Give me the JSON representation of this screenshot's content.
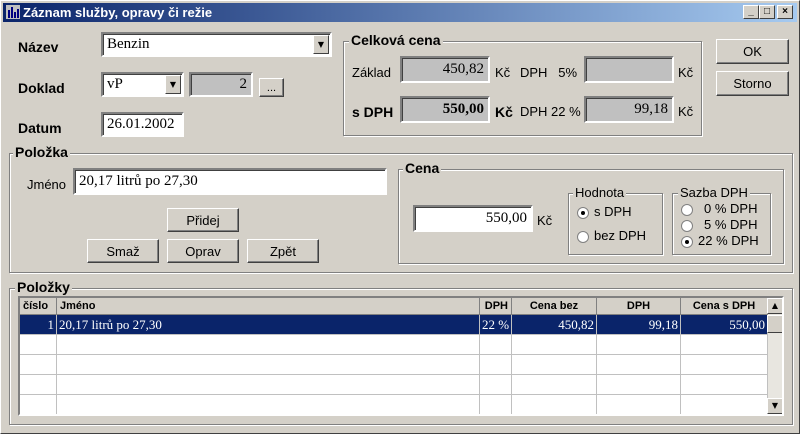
{
  "window": {
    "title": "Záznam služby, opravy či režie",
    "controls": {
      "minimize": "_",
      "maximize": "□",
      "close": "×"
    }
  },
  "form": {
    "nazev_label": "Název",
    "nazev_value": "Benzin",
    "doklad_label": "Doklad",
    "doklad_type": "vP",
    "doklad_number": "2",
    "doklad_browse": "...",
    "datum_label": "Datum",
    "datum_value": "26.01.2002"
  },
  "total": {
    "group_title": "Celková cena",
    "zaklad_label": "Základ",
    "zaklad_value": "450,82",
    "zaklad_currency": "Kč",
    "dph5_label": "DPH   5%",
    "dph5_value": "",
    "dph5_currency": "Kč",
    "sdph_label": "s DPH",
    "sdph_value": "550,00",
    "sdph_currency": "Kč",
    "dph22_label": "DPH 22 %",
    "dph22_value": "99,18",
    "dph22_currency": "Kč"
  },
  "buttons": {
    "ok": "OK",
    "storno": "Storno"
  },
  "item": {
    "group_title": "Položka",
    "jmeno_label": "Jméno",
    "jmeno_value": "20,17 litrů po 27,30",
    "pridej": "Přidej",
    "smaz": "Smaž",
    "oprav": "Oprav",
    "zpet": "Zpět"
  },
  "price": {
    "group_title": "Cena",
    "value": "550,00",
    "currency": "Kč",
    "hodnota": {
      "title": "Hodnota",
      "options": [
        "s DPH",
        "bez DPH"
      ],
      "selected": 0
    },
    "sazba": {
      "title": "Sazba DPH",
      "options": [
        "0 % DPH",
        "5 % DPH",
        "22 % DPH"
      ],
      "selected": 2
    }
  },
  "items_table": {
    "group_title": "Položky",
    "columns": [
      "číslo",
      "Jméno",
      "DPH",
      "Cena bez",
      "DPH",
      "Cena s DPH"
    ],
    "rows": [
      {
        "cislo": "1",
        "jmeno": "20,17 litrů po 27,30",
        "dph": "22 %",
        "cena_bez": "450,82",
        "dph_amount": "99,18",
        "cena_s_dph": "550,00"
      }
    ]
  }
}
